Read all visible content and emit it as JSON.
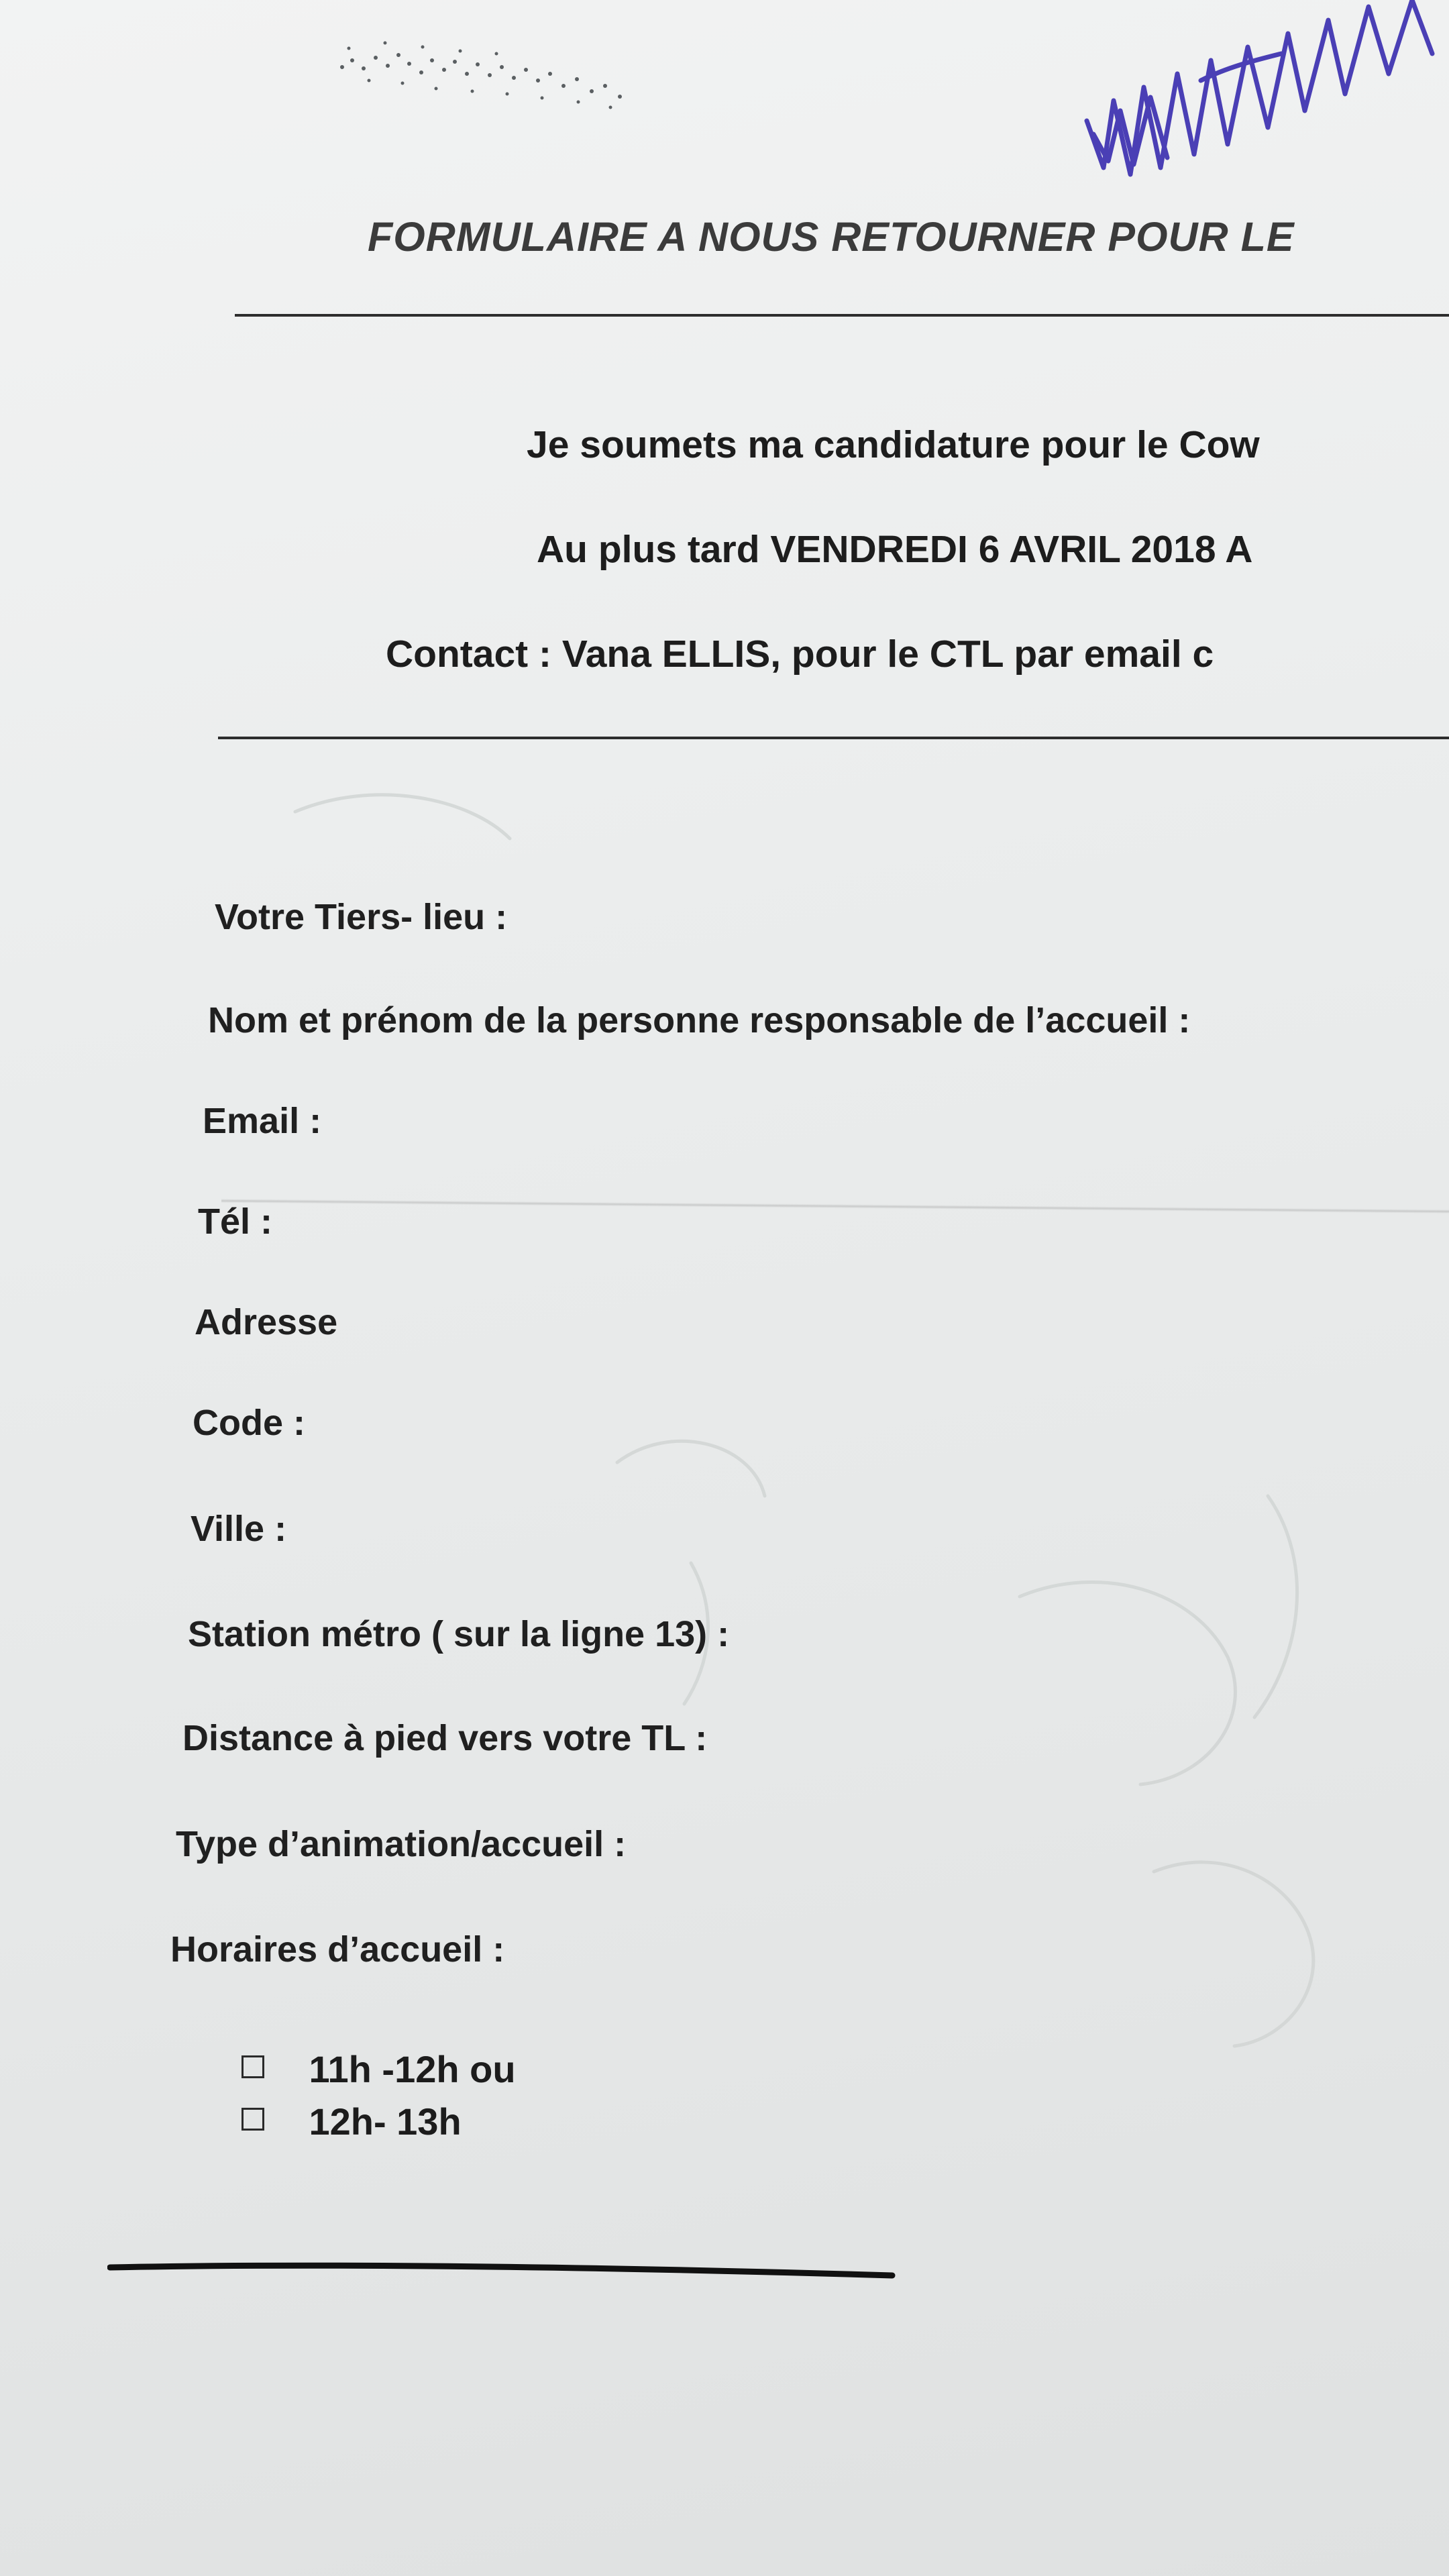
{
  "document": {
    "header_title": "FORMULAIRE A NOUS RETOURNER POUR LE",
    "intro_lines": [
      "Je soumets ma candidature pour le Cow",
      "Au plus tard VENDREDI 6 AVRIL 2018 A",
      "Contact : Vana ELLIS, pour le CTL  par email c"
    ],
    "fields": [
      "Votre Tiers- lieu :",
      "Nom et prénom de la personne responsable de l’accueil :",
      "Email :",
      "Tél :",
      "Adresse",
      "Code :",
      "Ville :",
      "Station métro ( sur la ligne 13) :",
      "Distance à pied vers votre TL :",
      "Type d’animation/accueil :",
      "Horaires d’accueil :"
    ],
    "options": [
      "11h -12h ou",
      "12h- 13h"
    ]
  },
  "colors": {
    "paper": "#ebeded",
    "text": "#1d1d1d",
    "ink_signature": "#4a3fb5",
    "rule": "#2d2d2d"
  }
}
